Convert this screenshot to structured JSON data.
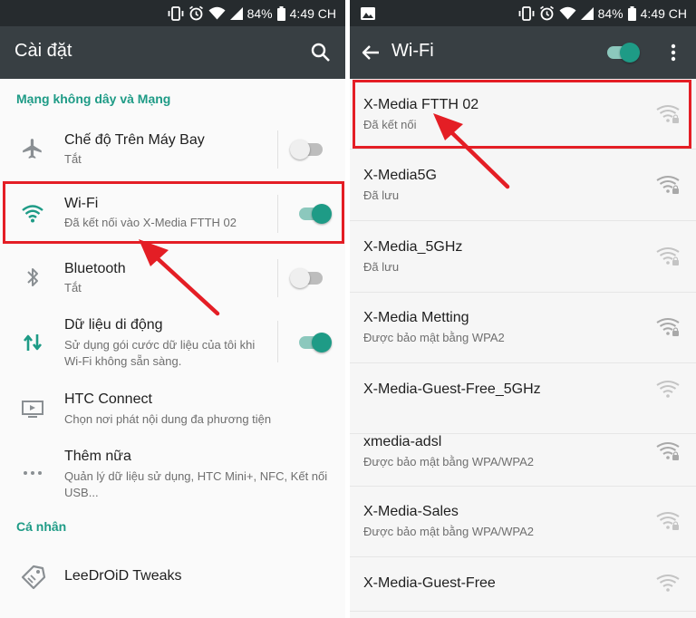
{
  "status_bar": {
    "battery": "84%",
    "time": "4:49 CH"
  },
  "settings": {
    "title": "Cài đặt",
    "section_wireless": "Mạng không dây và Mạng",
    "section_personal": "Cá nhân",
    "items": [
      {
        "title": "Chế độ Trên Máy Bay",
        "subtitle": "Tắt",
        "toggle": "off"
      },
      {
        "title": "Wi-Fi",
        "subtitle": "Đã kết nối vào X-Media FTTH 02",
        "toggle": "on"
      },
      {
        "title": "Bluetooth",
        "subtitle": "Tắt",
        "toggle": "off"
      },
      {
        "title": "Dữ liệu di động",
        "subtitle": "Sử dụng gói cước dữ liệu của tôi khi Wi-Fi không sẵn sàng.",
        "toggle": "on"
      },
      {
        "title": "HTC Connect",
        "subtitle": "Chọn nơi phát nội dung đa phương tiện"
      },
      {
        "title": "Thêm nữa",
        "subtitle": "Quản lý dữ liệu sử dụng, HTC Mini+, NFC, Kết nối USB..."
      },
      {
        "title": "LeeDrOiD Tweaks"
      }
    ]
  },
  "wifi": {
    "title": "Wi-Fi",
    "master_toggle": "on",
    "networks": [
      {
        "name": "X-Media FTTH 02",
        "status": "Đã kết nối",
        "secured": true
      },
      {
        "name": "X-Media5G",
        "status": "Đã lưu",
        "secured": true
      },
      {
        "name": "X-Media_5GHz",
        "status": "Đã lưu",
        "secured": true
      },
      {
        "name": "X-Media Metting",
        "status": "Được bảo mật bằng WPA2",
        "secured": true
      },
      {
        "name": "X-Media-Guest-Free_5GHz",
        "status": "",
        "secured": false
      },
      {
        "name": "xmedia-adsl",
        "status": "Được bảo mật bằng WPA/WPA2",
        "secured": true
      },
      {
        "name": "X-Media-Sales",
        "status": "Được bảo mật bằng WPA/WPA2",
        "secured": true
      },
      {
        "name": "X-Media-Guest-Free",
        "status": "",
        "secured": false
      }
    ]
  },
  "colors": {
    "accent": "#1e9b86",
    "status_bar": "#262b2e",
    "app_bar": "#383f43",
    "annotation": "#e41e25"
  },
  "icons": {
    "settings_search": "search-icon",
    "wifi_back": "arrow-back-icon",
    "wifi_overflow": "more-vert-icon",
    "airplane": "airplane-icon",
    "wifi": "wifi-icon",
    "bluetooth": "bluetooth-icon",
    "mobile_data": "swap-vert-icon",
    "htc_connect": "cast-icon",
    "more": "more-horiz-icon",
    "tweaks": "tag-icon"
  }
}
